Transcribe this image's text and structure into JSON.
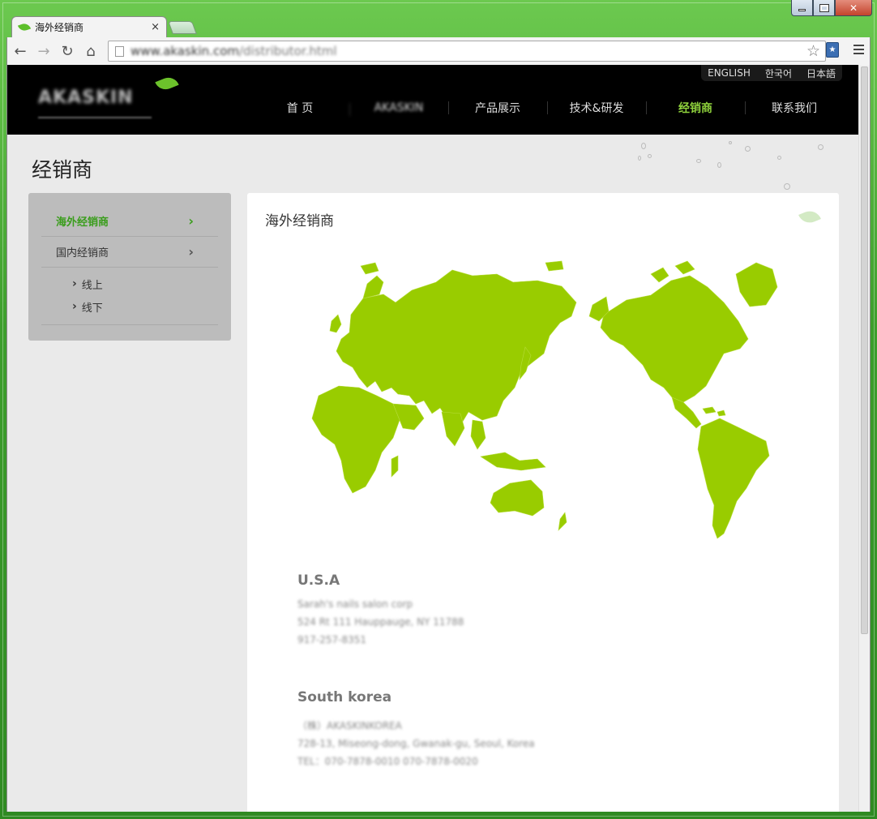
{
  "browser": {
    "tab_title": "海外经销商",
    "tab_close": "×",
    "url": "www.akaskin.com/distributor.html",
    "url_host": "www.akaskin.com",
    "url_path": "/distributor.html",
    "ext_label": "★"
  },
  "site": {
    "logo_text": "AKASKIN",
    "languages": [
      "ENGLISH",
      "한국어",
      "日本語"
    ],
    "nav": [
      "首 页",
      "AKASKIN",
      "产品展示",
      "技术&研发",
      "经销商",
      "联系我们"
    ],
    "page_title": "经销商"
  },
  "sidebar": {
    "items": [
      {
        "label": "海外经销商",
        "chevron": "›"
      },
      {
        "label": "国内经销商",
        "chevron": "›"
      }
    ],
    "subitems": [
      "线上",
      "线下"
    ]
  },
  "panel": {
    "title": "海外经销商",
    "map_color": "#99cc00",
    "distributors": [
      {
        "country": "U.S.A",
        "lines": [
          "Sarah's nails salon corp",
          "524 Rt 111 Hauppauge, NY 11788",
          "917-257-8351"
        ]
      },
      {
        "country": "South korea",
        "lines": [
          "（株）AKASKINKOREA",
          "728-13, Miseong-dong, Gwanak-gu, Seoul, Korea",
          "TEL：070-7878-0010 070-7878-0020"
        ]
      }
    ]
  },
  "colors": {
    "accent_green": "#8fd23c",
    "active_green": "#3a9d1c",
    "header_bg": "#000000"
  }
}
